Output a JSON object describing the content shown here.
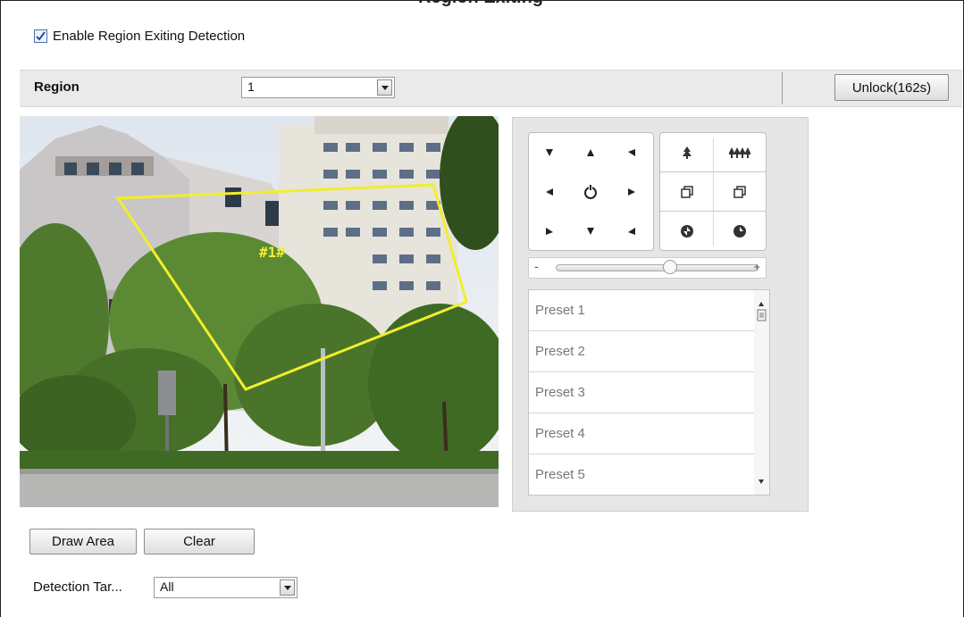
{
  "page": {
    "title_fragment": "Region Exiting"
  },
  "enable": {
    "label": "Enable Region Exiting Detection",
    "checked": true
  },
  "region": {
    "label": "Region",
    "selected": "1",
    "unlock_label": "Unlock(162s)"
  },
  "video": {
    "region_tag": "#1#",
    "region_color": "#f2ee2a"
  },
  "ptz": {
    "direction_icons": [
      "arrow-up-left-icon",
      "arrow-up-icon",
      "arrow-up-right-icon",
      "arrow-left-icon",
      "auto-rotate-icon",
      "arrow-right-icon",
      "arrow-down-left-icon",
      "arrow-down-icon",
      "arrow-down-right-icon"
    ],
    "lens_icons": [
      "zoom-in-icon",
      "zoom-out-icon",
      "focus-near-icon",
      "focus-far-icon",
      "iris-open-icon",
      "iris-close-icon"
    ],
    "speed": {
      "minus": "-",
      "plus": "+",
      "value_fraction": 0.6
    },
    "presets": [
      "Preset 1",
      "Preset 2",
      "Preset 3",
      "Preset 4",
      "Preset 5"
    ]
  },
  "actions": {
    "draw_label": "Draw Area",
    "clear_label": "Clear"
  },
  "detection_target": {
    "label": "Detection Tar...",
    "selected": "All"
  }
}
